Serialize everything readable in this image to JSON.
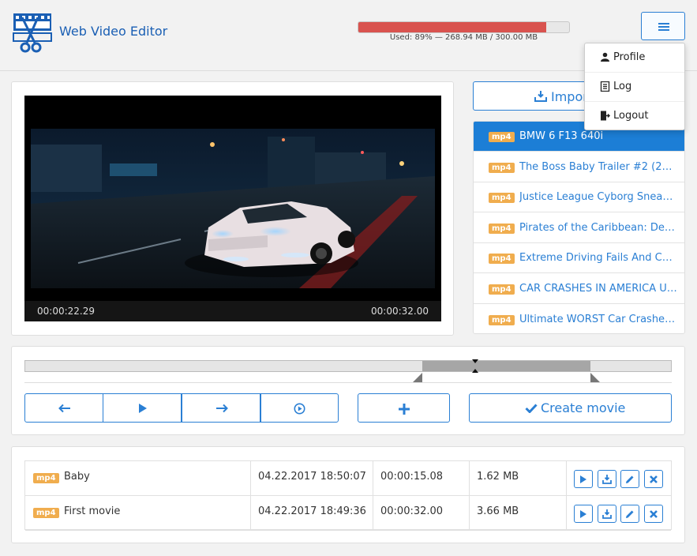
{
  "app": {
    "title": "Web Video Editor",
    "logo_icon": "film-scissors-logo-icon"
  },
  "storage": {
    "label": "Used: 89% — 268.94 MB / 300.00 MB",
    "fraction": 0.89,
    "color": "#d9534f"
  },
  "menu": {
    "icon": "hamburger-icon",
    "items": [
      {
        "label": "Profile",
        "icon": "user-icon"
      },
      {
        "label": "Log",
        "icon": "document-icon"
      },
      {
        "label": "Logout",
        "icon": "logout-icon"
      }
    ]
  },
  "player": {
    "current_time": "00:00:22.29",
    "total_time": "00:00:32.00"
  },
  "import": {
    "label": "Import",
    "icon": "import-icon"
  },
  "files": [
    {
      "format": "mp4",
      "name": "BMW 6 F13 640i",
      "active": true
    },
    {
      "format": "mp4",
      "name": "The Boss Baby Trailer #2 (201…",
      "active": false
    },
    {
      "format": "mp4",
      "name": "Justice League Cyborg Sneak …",
      "active": false
    },
    {
      "format": "mp4",
      "name": "Pirates of the Caribbean: Dea…",
      "active": false
    },
    {
      "format": "mp4",
      "name": "Extreme Driving Fails And Car…",
      "active": false
    },
    {
      "format": "mp4",
      "name": "CAR CRASHES IN AMERICA US…",
      "active": false
    },
    {
      "format": "mp4",
      "name": "Ultimate WORST Car Crashes -…",
      "active": false
    }
  ],
  "timeline": {
    "selection_start": 0.6155,
    "selection_end": 0.8753,
    "playhead": 0.6966
  },
  "controls": {
    "prev_icon": "arrow-left-icon",
    "play_icon": "play-icon",
    "next_icon": "arrow-right-icon",
    "play_selection_icon": "play-circle-icon",
    "add_icon": "plus-icon",
    "create_label": "Create movie",
    "create_icon": "check-icon"
  },
  "movies": [
    {
      "format": "mp4",
      "name": "Baby",
      "created": "04.22.2017 18:50:07",
      "duration": "00:00:15.08",
      "size": "1.62 MB"
    },
    {
      "format": "mp4",
      "name": "First movie",
      "created": "04.22.2017 18:49:36",
      "duration": "00:00:32.00",
      "size": "3.66 MB"
    }
  ],
  "colors": {
    "accent": "#2a7fd4",
    "active": "#1c7ed6",
    "badge": "#f0ad4e",
    "usage": "#d9534f"
  }
}
